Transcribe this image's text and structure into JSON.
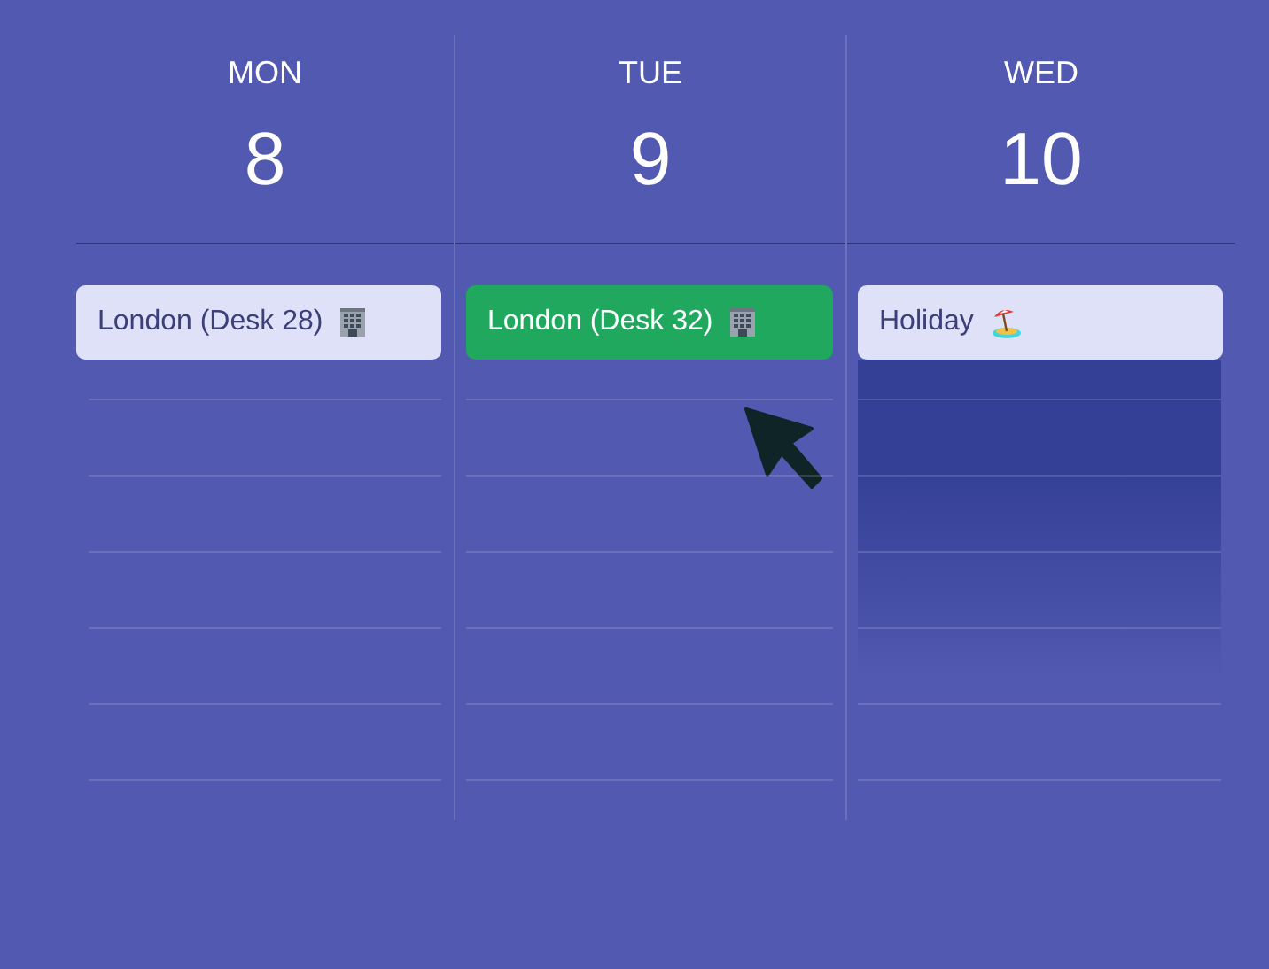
{
  "days": [
    {
      "name": "MON",
      "date": "8",
      "events": [
        {
          "kind": "office",
          "label": "London (Desk 28)",
          "selected": false
        }
      ]
    },
    {
      "name": "TUE",
      "date": "9",
      "events": [
        {
          "kind": "office",
          "label": "London (Desk 32)",
          "selected": true
        }
      ]
    },
    {
      "name": "WED",
      "date": "10",
      "events": [
        {
          "kind": "holiday",
          "label": "Holiday",
          "selected": false
        }
      ]
    }
  ]
}
